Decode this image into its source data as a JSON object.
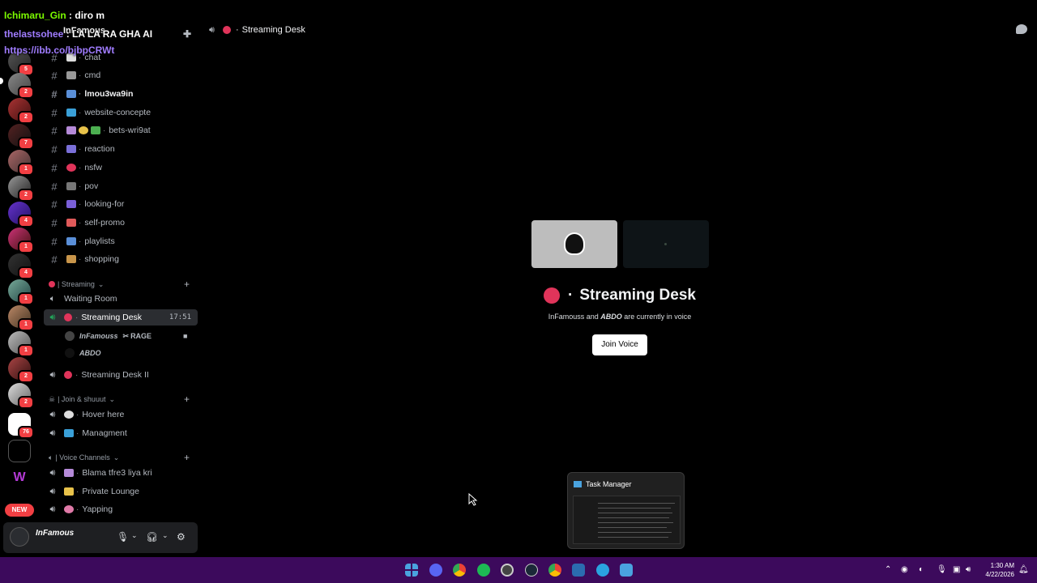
{
  "overlay": {
    "line1_user": "Ichimaru_Gin",
    "line1_msg": ": diro m",
    "line2_user": "thelastsohee",
    "line2_msg": ": LA LA RA GHA AI",
    "line3_link": "https://ibb.co/bjbpCRWt"
  },
  "server": {
    "name": "InFamous"
  },
  "rail": {
    "badges": [
      "5",
      "2",
      "2",
      "7",
      "1",
      "2",
      "4",
      "1",
      "4",
      "1",
      "1",
      "1",
      "2",
      "2",
      "76"
    ],
    "new_label": "NEW"
  },
  "channels": [
    {
      "name": "chat"
    },
    {
      "name": "cmd"
    },
    {
      "name": "lmou3wa9in"
    },
    {
      "name": "website-concepte"
    },
    {
      "name": "bets-wri9at"
    },
    {
      "name": "reaction"
    },
    {
      "name": "nsfw"
    },
    {
      "name": "pov"
    },
    {
      "name": "looking-for"
    },
    {
      "name": "self-promo"
    },
    {
      "name": "playlists"
    },
    {
      "name": "shopping"
    }
  ],
  "categories": {
    "streaming": "| Streaming",
    "join": "| Join & shuuut",
    "voice": "| Voice Channels"
  },
  "voice": {
    "waiting_room": "Waiting Room",
    "streaming_desk": "Streaming Desk",
    "timer": "17:51",
    "user1": "InFamouss",
    "user1_tag": "RAGE",
    "user2": "ABDO",
    "streaming_desk_2": "Streaming Desk II",
    "hover_here": "Hover here",
    "managment": "Managment",
    "blama": "Blama tfre3 liya kri",
    "private_lounge": "Private Lounge",
    "yapping": "Yapping"
  },
  "user_panel": {
    "username": "InFamous"
  },
  "main": {
    "topbar_title": "Streaming Desk",
    "title": "Streaming Desk",
    "subtitle_user1": "InFamouss",
    "subtitle_and": " and ",
    "subtitle_user2": "ABDO",
    "subtitle_rest": " are currently in voice",
    "join_button": "Join Voice"
  },
  "task_manager": {
    "title": "Task Manager"
  },
  "taskbar": {
    "clock_time": "1:30 AM",
    "clock_date": "4/22/2026",
    "icons": [
      "windows-start",
      "discord",
      "chrome",
      "spotify",
      "obs",
      "steam",
      "chrome-alt",
      "task-manager",
      "telegram",
      "photos"
    ]
  },
  "colors": {
    "accent_red": "#e0345a",
    "taskbar": "#3c0a5c",
    "badge_red": "#f23f43"
  }
}
